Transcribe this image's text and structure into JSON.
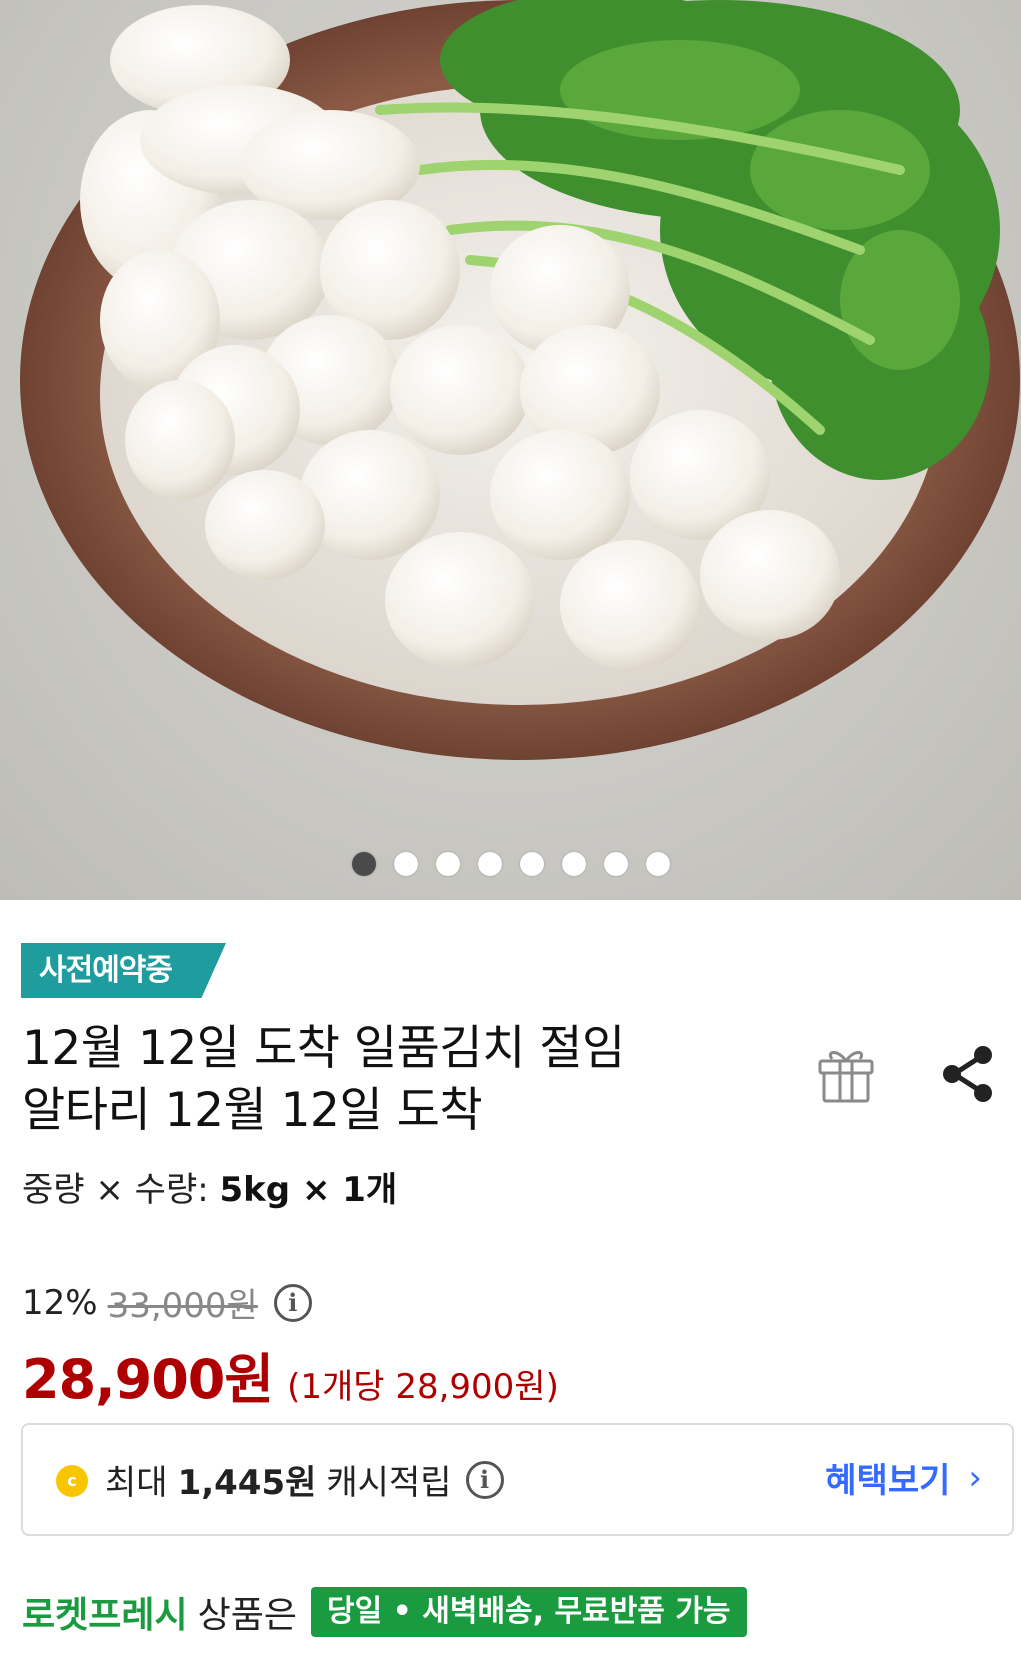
{
  "image_carousel": {
    "alt": "product photo",
    "total_images": 8,
    "active_index": 0
  },
  "badge": {
    "label": "사전예약중",
    "color": "#1f9c9e"
  },
  "product": {
    "title_line1": "12월 12일 도착 일품김치 절임",
    "title_line2": "알타리 12월 12일 도착",
    "option_label": "중량 × 수량:",
    "option_value": "5kg × 1개"
  },
  "actions": {
    "gift_icon": "gift-icon",
    "share_icon": "share-icon"
  },
  "price": {
    "discount_rate": "12%",
    "original_price": "33,000원",
    "sale_price": "28,900원",
    "unit_price": "(1개당 28,900원)",
    "sale_color": "#ae0000"
  },
  "cash_reward": {
    "coin_symbol": "c",
    "prefix": "최대",
    "amount": "1,445원",
    "suffix": "캐시적립",
    "link_label": "혜택보기",
    "link_color": "#346aff"
  },
  "delivery": {
    "brand": "로켓프레시",
    "suffix": "상품은",
    "tag": "당일 • 새벽배송, 무료반품 가능",
    "color": "#1a9b3f"
  }
}
